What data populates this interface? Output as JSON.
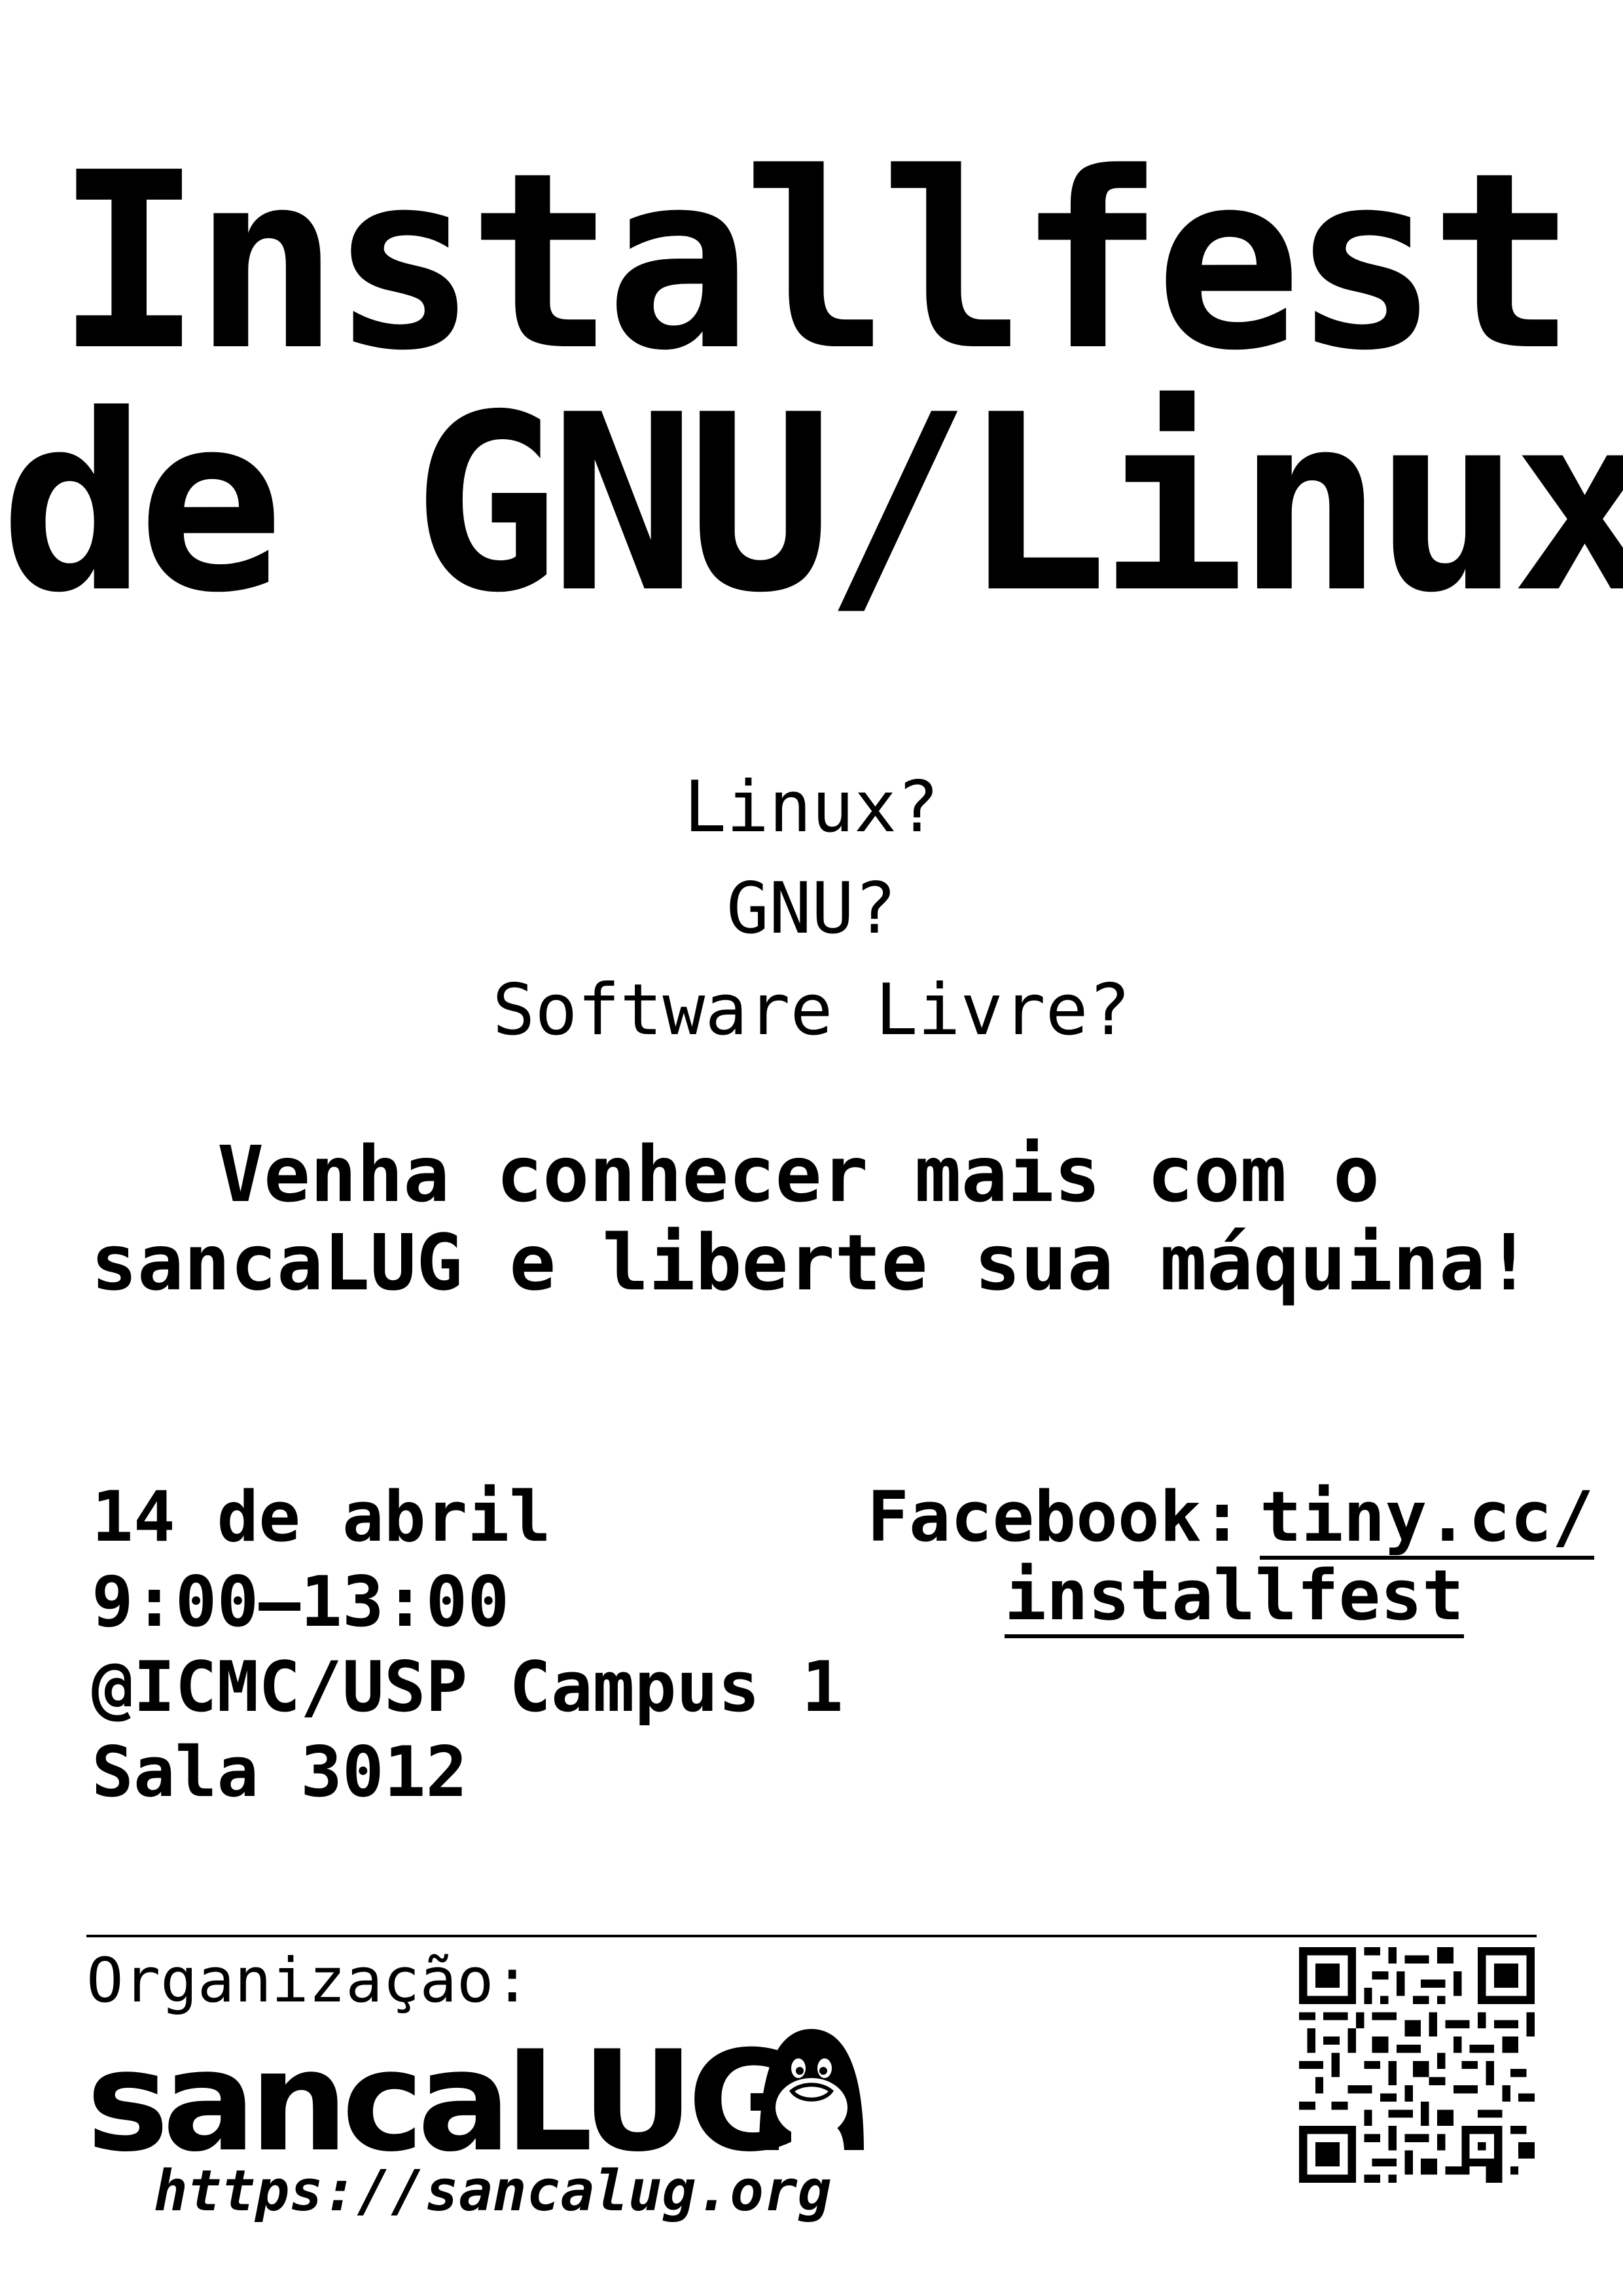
{
  "title": {
    "line1": "Installfest",
    "line2": "de GNU/Linux"
  },
  "questions": [
    "Linux?",
    "GNU?",
    "Software Livre?"
  ],
  "call_to_action": {
    "line1": "Venha conhecer mais com o",
    "line2": "sancaLUG e liberte sua máquina!"
  },
  "event": {
    "date": "14 de abril",
    "time": "9:00–13:00",
    "location": "@ICMC/USP Campus 1",
    "room": "Sala 3012"
  },
  "facebook": {
    "label": "Facebook:",
    "link_line1": "tiny.cc/",
    "link_line2": "installfest"
  },
  "organization": {
    "label": "Organização:",
    "logo_text": "sancaLUG",
    "logo_icon": "tux-penguin-icon",
    "website": "https://sancalug.org"
  },
  "qr_code": {
    "icon": "qr-code-icon"
  }
}
